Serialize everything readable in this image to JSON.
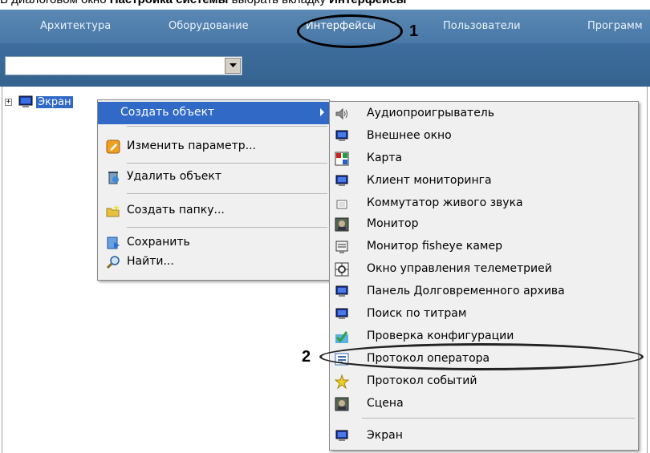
{
  "caption": {
    "prefix": "В диалоговом окно ",
    "bold1": "Настройка системы",
    "middle": " выбрать вкладку ",
    "bold2": "Интерфейсы"
  },
  "tabs": [
    {
      "label": "Архитектура"
    },
    {
      "label": "Оборудование"
    },
    {
      "label": "Интерфейсы"
    },
    {
      "label": "Пользователи"
    },
    {
      "label": "Программ"
    }
  ],
  "combo": {
    "value": ""
  },
  "tree": {
    "root_label": "Экран"
  },
  "menu1": {
    "items": [
      {
        "label": "Создать объект",
        "icon": "none",
        "selected": true
      },
      {
        "label": "Изменить параметр...",
        "icon": "edit-icon"
      },
      {
        "label": "Удалить объект",
        "icon": "delete-icon"
      },
      {
        "label": "Создать папку...",
        "icon": "folder-new-icon"
      },
      {
        "label": "Сохранить",
        "icon": "save-icon"
      },
      {
        "label": "Найти...",
        "icon": "search-icon"
      }
    ]
  },
  "menu2": {
    "items": [
      {
        "label": "Аудиопроигрыватель",
        "icon": "speaker-icon"
      },
      {
        "label": "Внешнее окно",
        "icon": "monitor-icon"
      },
      {
        "label": "Карта",
        "icon": "map-icon"
      },
      {
        "label": "Клиент мониторинга",
        "icon": "monitor-icon"
      },
      {
        "label": "Коммутатор живого звука",
        "icon": "sound-switch-icon"
      },
      {
        "label": "Монитор",
        "icon": "video-monitor-icon"
      },
      {
        "label": "Монитор fisheye камер",
        "icon": "fisheye-icon"
      },
      {
        "label": "Окно управления телеметрией",
        "icon": "telemetry-icon"
      },
      {
        "label": "Панель Долговременного архива",
        "icon": "monitor-icon"
      },
      {
        "label": "Поиск по титрам",
        "icon": "monitor-icon"
      },
      {
        "label": "Проверка конфигурации",
        "icon": "config-check-icon"
      },
      {
        "label": "Протокол оператора",
        "icon": "protocol-icon"
      },
      {
        "label": "Протокол событий",
        "icon": "events-icon"
      },
      {
        "label": "Сцена",
        "icon": "scene-icon"
      },
      {
        "label": "Экран",
        "icon": "screen-icon"
      }
    ]
  },
  "annotations": {
    "marker1": "1",
    "marker2": "2"
  },
  "colors": {
    "tabbar": "#4a79a8",
    "selection": "#3169c6",
    "menu_bg": "#f0f0f0"
  }
}
